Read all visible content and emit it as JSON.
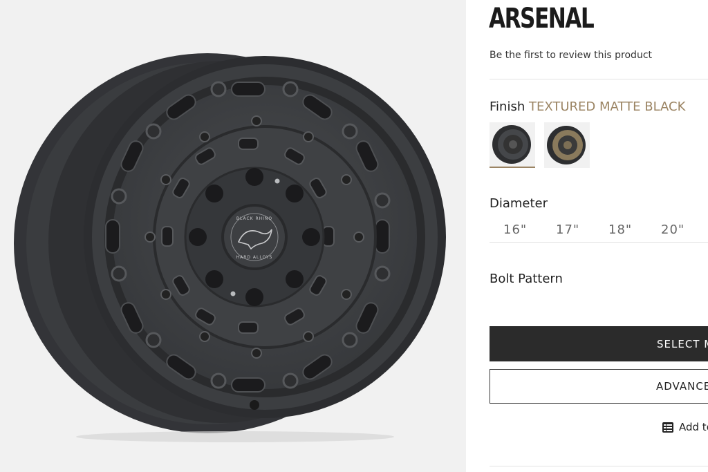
{
  "product": {
    "title": "ARSENAL",
    "review_link": "Be the first to review this product",
    "logo_text": "BLACK RHINO HARD ALLOYS"
  },
  "finish": {
    "label": "Finish",
    "selected": "TEXTURED MATTE BLACK",
    "swatches": [
      "textured-matte-black",
      "sand-finish"
    ]
  },
  "diameter": {
    "label": "Diameter",
    "options": [
      "16\"",
      "17\"",
      "18\"",
      "20\""
    ]
  },
  "bolt_pattern": {
    "label": "Bolt Pattern"
  },
  "actions": {
    "select_label": "SELECT M",
    "advanced_label": "ADVANCE",
    "add_label": "Add to"
  },
  "colors": {
    "accent": "#9b8463",
    "primary_button": "#2b2b2b",
    "gallery_bg": "#f1f1f1"
  }
}
